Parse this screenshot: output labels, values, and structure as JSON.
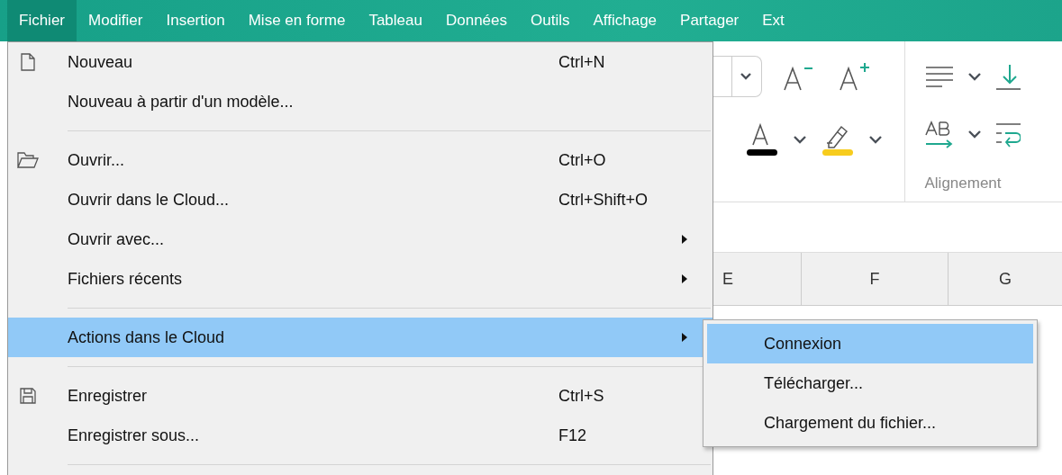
{
  "menu_bar": [
    {
      "label": "Fichier",
      "selected": true
    },
    {
      "label": "Modifier",
      "selected": false
    },
    {
      "label": "Insertion",
      "selected": false
    },
    {
      "label": "Mise en forme",
      "selected": false
    },
    {
      "label": "Tableau",
      "selected": false
    },
    {
      "label": "Données",
      "selected": false
    },
    {
      "label": "Outils",
      "selected": false
    },
    {
      "label": "Affichage",
      "selected": false
    },
    {
      "label": "Partager",
      "selected": false
    },
    {
      "label": "Ext",
      "selected": false
    }
  ],
  "ribbon": {
    "group_label": "Alignement"
  },
  "sheet": {
    "column_headers": [
      "E",
      "F",
      "G"
    ]
  },
  "file_menu": [
    {
      "kind": "item",
      "label": "Nouveau",
      "shortcut": "Ctrl+N",
      "submenu": false,
      "selected": false
    },
    {
      "kind": "item",
      "label": "Nouveau à partir d'un modèle...",
      "submenu": false,
      "selected": false
    },
    {
      "kind": "separator"
    },
    {
      "kind": "item",
      "label": "Ouvrir...",
      "shortcut": "Ctrl+O",
      "submenu": false,
      "selected": false
    },
    {
      "kind": "item",
      "label": "Ouvrir dans le Cloud...",
      "shortcut": "Ctrl+Shift+O",
      "submenu": false,
      "selected": false
    },
    {
      "kind": "item",
      "label": "Ouvrir avec...",
      "submenu": true,
      "selected": false
    },
    {
      "kind": "item",
      "label": "Fichiers récents",
      "submenu": true,
      "selected": false
    },
    {
      "kind": "separator"
    },
    {
      "kind": "item",
      "label": "Actions dans le Cloud",
      "submenu": true,
      "selected": true
    },
    {
      "kind": "separator"
    },
    {
      "kind": "item",
      "label": "Enregistrer",
      "shortcut": "Ctrl+S",
      "submenu": false,
      "selected": false
    },
    {
      "kind": "item",
      "label": "Enregistrer sous...",
      "shortcut": "F12",
      "submenu": false,
      "selected": false
    },
    {
      "kind": "separator"
    }
  ],
  "submenu": [
    {
      "label": "Connexion",
      "selected": true
    },
    {
      "label": "Télécharger...",
      "selected": false
    },
    {
      "label": "Chargement du fichier...",
      "selected": false
    }
  ]
}
